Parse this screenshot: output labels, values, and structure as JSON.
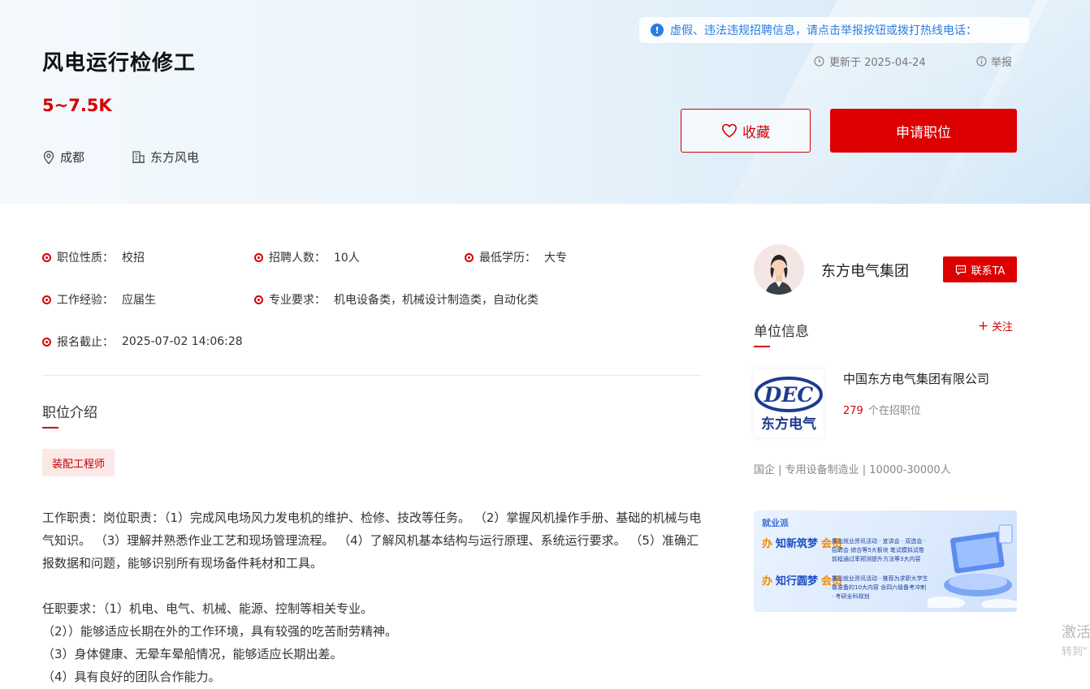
{
  "job": {
    "title": "风电运行检修工",
    "salary": "5~7.5K",
    "location": "成都",
    "company": "东方风电"
  },
  "notice": {
    "text": "虚假、违法违规招聘信息，请点击举报按钮或拨打热线电话：",
    "icon": "info-icon"
  },
  "updated": "更新于 2025-04-24",
  "report_label": "举报",
  "buttons": {
    "favorite": "收藏",
    "apply": "申请职位"
  },
  "attributes": [
    {
      "label": "职位性质：",
      "value": "校招"
    },
    {
      "label": "招聘人数：",
      "value": "10人"
    },
    {
      "label": "最低学历：",
      "value": "大专"
    },
    {
      "label": "工作经验：",
      "value": "应届生"
    },
    {
      "label": "专业要求：",
      "value": "机电设备类，机械设计制造类，自动化类"
    },
    {
      "label": "报名截止：",
      "value": "2025-07-02 14:06:28"
    }
  ],
  "intro": {
    "title": "职位介绍",
    "tag": "装配工程师",
    "duty": "工作职责：岗位职责：（1）完成风电场风力发电机的维护、检修、技改等任务。 （2）掌握风机操作手册、基础的机械与电气知识。 （3）理解并熟悉作业工艺和现场管理流程。 （4）了解风机基本结构与运行原理、系统运行要求。 （5）准确汇报数据和问题，能够识别所有现场备件耗材和工具。",
    "req_lines": [
      "任职要求：（1）机电、电气、机械、能源、控制等相关专业。",
      "（2））能够适应长期在外的工作环境，具有较强的吃苦耐劳精神。",
      "（3）身体健康、无晕车晕船情况，能够适应长期出差。",
      "（4）具有良好的团队合作能力。"
    ]
  },
  "sidebar": {
    "recruiter_name": "东方电气集团",
    "contact_label": "联系TA",
    "unit_title": "单位信息",
    "follow_label": "关注",
    "company_full": "中国东方电气集团有限公司",
    "openings_count": "279",
    "openings_label": "个在招职位",
    "company_info": "国企 | 专用设备制造业 | 10000-30000人",
    "logo_text_top": "DEC",
    "logo_text_bottom": "东方电气"
  },
  "banner": {
    "logo": "就业派",
    "row1_a": "办",
    "row1_b": "知新筑梦",
    "row1_c": "会员",
    "row1_text": "推出就业资讯活动 · 宣讲会 · 双选会 · 招聘会 综合等5大板块 笔试模拟试卷 前程通过率预测提升方法等3大内容",
    "row2_a": "办",
    "row2_b": "知行圆梦",
    "row2_c": "会员",
    "row2_text": "推出就业资讯活动 · 推荐为求职大学生做准备的10大内容 含四六级备考冲刺 · 考研全科规划"
  },
  "watermark": {
    "line1": "激活",
    "line2": "转到\""
  },
  "colors": {
    "accent": "#dd0000",
    "link": "#2a7de1"
  }
}
